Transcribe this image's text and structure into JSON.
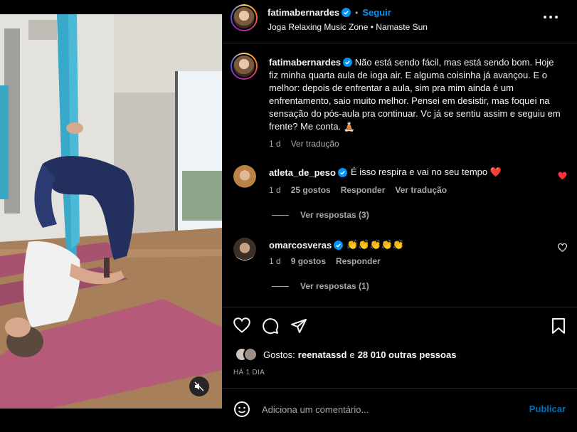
{
  "post": {
    "author": "fatimabernardes",
    "follow_label": "Seguir",
    "dot": "•",
    "audio": "Joga Relaxing Music Zone • Namaste Sun"
  },
  "caption": {
    "author": "fatimabernardes",
    "text": "Não está sendo fácil, mas está sendo bom. Hoje fiz minha quarta aula de ioga air. E alguma coisinha já avançou. E o melhor: depois de enfrentar a aula, sim pra mim ainda é um enfrentamento, saio muito melhor. Pensei em desistir, mas foquei na sensação do pós-aula pra continuar. Vc já se sentiu assim e seguiu em frente? Me conta. 🧘🏻",
    "time": "1 d",
    "translate": "Ver tradução"
  },
  "comments": [
    {
      "author": "atleta_de_peso",
      "text": "É isso respira e vai no seu tempo ❤️",
      "time": "1 d",
      "likes": "25 gostos",
      "reply": "Responder",
      "translate": "Ver tradução",
      "view_replies": "Ver respostas (3)",
      "liked": true
    },
    {
      "author": "omarcosveras",
      "text": "👏👏👏👏👏",
      "time": "1 d",
      "likes": "9 gostos",
      "reply": "Responder",
      "view_replies": "Ver respostas (1)",
      "liked": false
    }
  ],
  "likes_summary": {
    "label": "Gostos:",
    "first_user": "reenatassd",
    "connector": "e",
    "others": "28 010 outras pessoas"
  },
  "timestamp": "HÁ 1 DIA",
  "add_comment": {
    "placeholder": "Adiciona um comentário...",
    "publish_label": "Publicar"
  },
  "colors": {
    "accent": "#0095f6",
    "background": "#000000",
    "heart": "#ff3040",
    "secondary_text": "#a8a8a8"
  },
  "icons": [
    "heart-icon",
    "comment-icon",
    "share-icon",
    "bookmark-icon",
    "more-options-icon",
    "emoji-icon",
    "mute-icon",
    "verified-icon"
  ]
}
